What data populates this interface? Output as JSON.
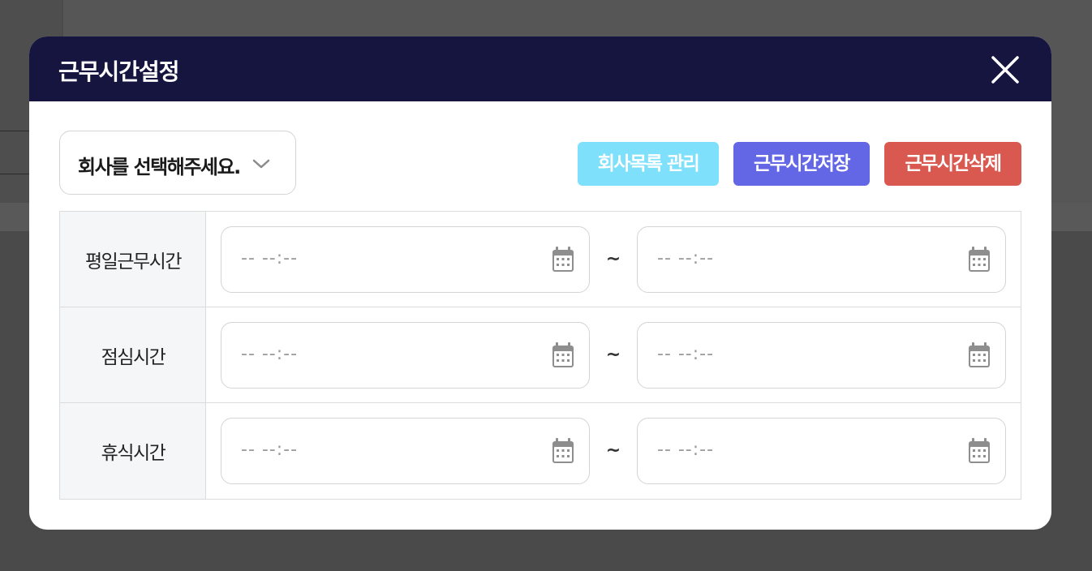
{
  "modal": {
    "title": "근무시간설정",
    "close_icon": "close-icon"
  },
  "company_select": {
    "label": "회사를 선택해주세요.",
    "icon": "chevron-down-icon"
  },
  "buttons": {
    "manage": "회사목록 관리",
    "save": "근무시간저장",
    "delete": "근무시간삭제"
  },
  "rows": [
    {
      "label": "평일근무시간",
      "start_placeholder": "-- --:--",
      "end_placeholder": "-- --:--"
    },
    {
      "label": "점심시간",
      "start_placeholder": "-- --:--",
      "end_placeholder": "-- --:--"
    },
    {
      "label": "휴식시간",
      "start_placeholder": "-- --:--",
      "end_placeholder": "-- --:--"
    }
  ],
  "separator": "~",
  "colors": {
    "header_bg": "#151540",
    "manage_button": "#7ee0fa",
    "save_button": "#6467e5",
    "delete_button": "#d9584f",
    "overlay": "#4a4a4a"
  }
}
